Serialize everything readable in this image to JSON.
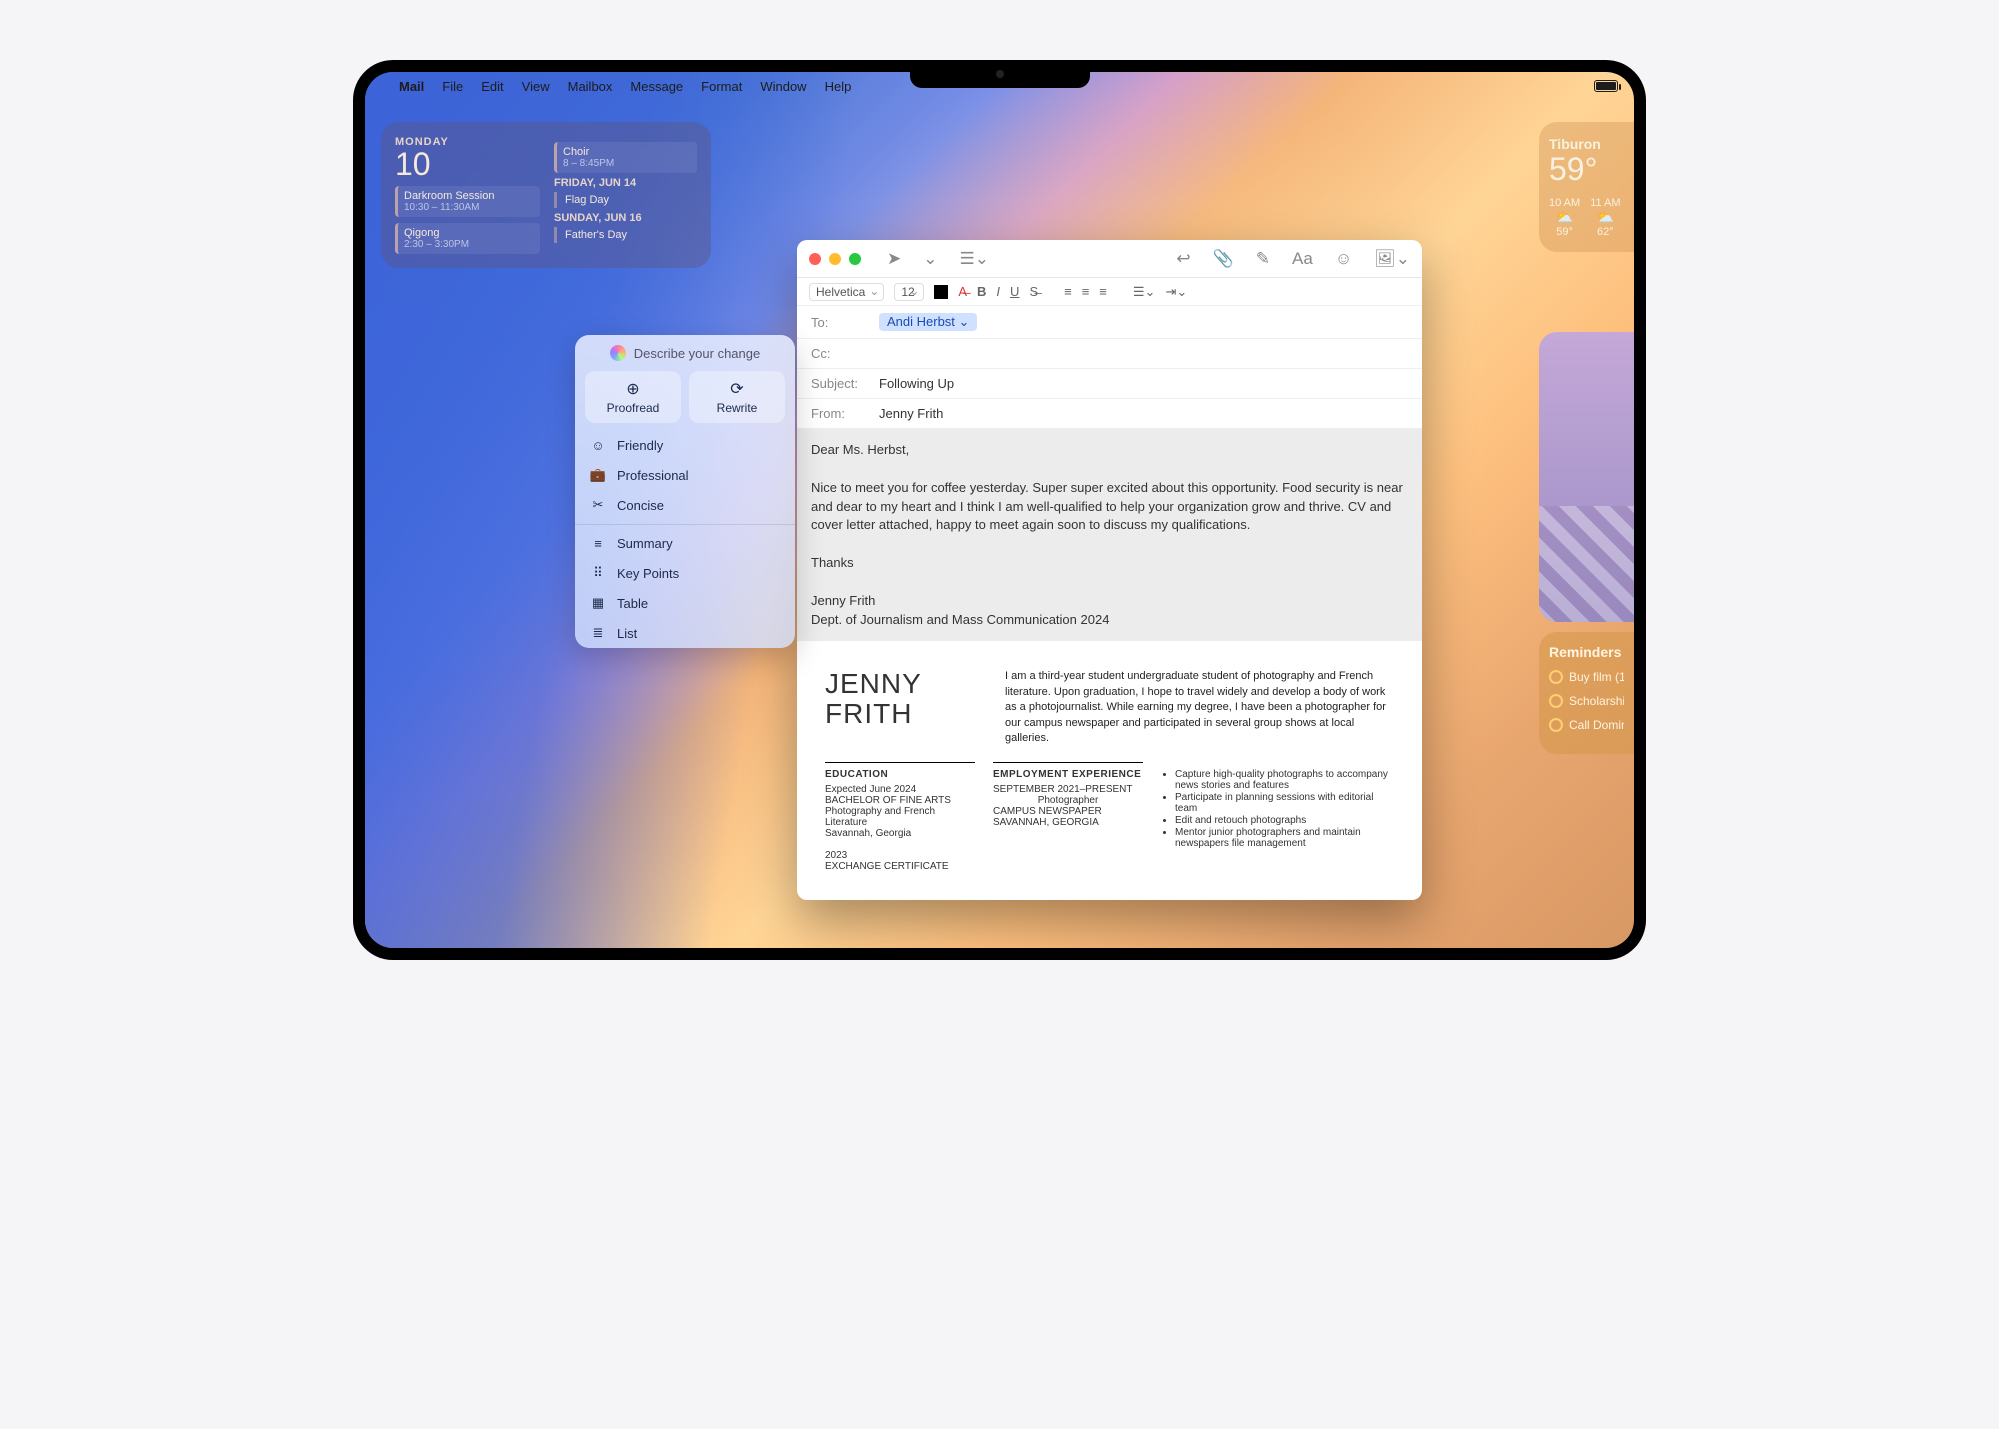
{
  "menubar": {
    "app": "Mail",
    "items": [
      "File",
      "Edit",
      "View",
      "Mailbox",
      "Message",
      "Format",
      "Window",
      "Help"
    ]
  },
  "calendar": {
    "day_label": "MONDAY",
    "day_num": "10",
    "left_events": [
      {
        "title": "Darkroom Session",
        "time": "10:30 – 11:30AM"
      },
      {
        "title": "Qigong",
        "time": "2:30 – 3:30PM"
      }
    ],
    "right": [
      {
        "type": "event",
        "title": "Choir",
        "time": "8 – 8:45PM"
      },
      {
        "type": "header",
        "text": "FRIDAY, JUN 14"
      },
      {
        "type": "item",
        "text": "Flag Day"
      },
      {
        "type": "header",
        "text": "SUNDAY, JUN 16"
      },
      {
        "type": "item",
        "text": "Father's Day"
      }
    ]
  },
  "weather": {
    "location": "Tiburon",
    "temp": "59°",
    "hours": [
      {
        "time": "10 AM",
        "icon": "⛅",
        "temp": "59°"
      },
      {
        "time": "11 AM",
        "icon": "⛅",
        "temp": "62°"
      }
    ]
  },
  "reminders": {
    "title": "Reminders",
    "items": [
      "Buy film (1:",
      "Scholarshi",
      "Call Domin"
    ]
  },
  "tools": {
    "header": "Describe your change",
    "proofread": "Proofread",
    "rewrite": "Rewrite",
    "rows": [
      {
        "icon": "☺",
        "label": "Friendly"
      },
      {
        "icon": "💼",
        "label": "Professional"
      },
      {
        "icon": "✂",
        "label": "Concise"
      }
    ],
    "rows2": [
      {
        "icon": "≡",
        "label": "Summary"
      },
      {
        "icon": "⠿",
        "label": "Key Points"
      },
      {
        "icon": "▦",
        "label": "Table"
      },
      {
        "icon": "≣",
        "label": "List"
      }
    ]
  },
  "compose": {
    "font": "Helvetica",
    "size": "12",
    "to_label": "To:",
    "to": "Andi Herbst",
    "cc_label": "Cc:",
    "subject_label": "Subject:",
    "subject": "Following Up",
    "from_label": "From:",
    "from": "Jenny Frith",
    "greeting": "Dear Ms. Herbst,",
    "para": "Nice to meet you for coffee yesterday. Super super excited about this opportunity. Food security is near and dear to my heart and I think I am well-qualified to help your organization grow and thrive. CV and cover letter attached, happy to meet again soon to discuss my qualifications.",
    "thanks": "Thanks",
    "sig1": "Jenny Frith",
    "sig2": "Dept. of Journalism and Mass Communication 2024"
  },
  "cv": {
    "name1": "JENNY",
    "name2": "FRITH",
    "summary": "I am a third-year student undergraduate student of photography and French literature. Upon graduation, I hope to travel widely and develop a body of work as a photojournalist. While earning my degree, I have been a photographer for our campus newspaper and participated in several group shows at local galleries.",
    "edu_h": "EDUCATION",
    "edu_lines": [
      "Expected June 2024",
      "BACHELOR OF FINE ARTS",
      "Photography and French Literature",
      "Savannah, Georgia",
      "",
      "2023",
      "EXCHANGE CERTIFICATE"
    ],
    "emp_h": "EMPLOYMENT EXPERIENCE",
    "emp_lines": [
      "SEPTEMBER 2021–PRESENT",
      "Photographer",
      "CAMPUS NEWSPAPER",
      "SAVANNAH, GEORGIA"
    ],
    "bullets": [
      "Capture high-quality photographs to accompany news stories and features",
      "Participate in planning sessions with editorial team",
      "Edit and retouch photographs",
      "Mentor junior photographers and maintain newspapers file management"
    ]
  }
}
